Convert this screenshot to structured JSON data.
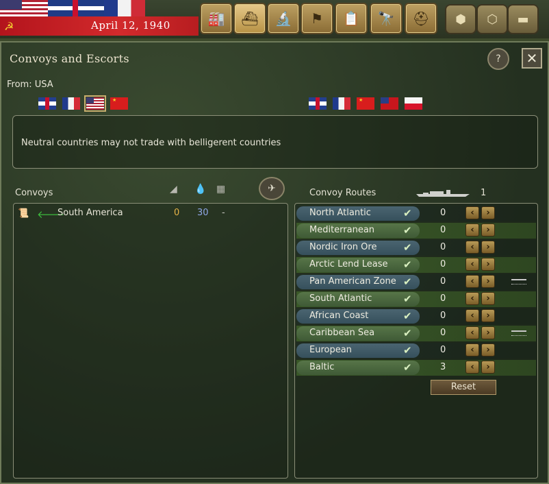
{
  "topbar": {
    "date": "April 12, 1940",
    "nav_buttons": [
      {
        "name": "production",
        "glyph": "🏭"
      },
      {
        "name": "convoys",
        "glyph": "⛴",
        "active": true
      },
      {
        "name": "research",
        "glyph": "🔬"
      },
      {
        "name": "objectives",
        "glyph": "⚑"
      },
      {
        "name": "reports",
        "glyph": "📋"
      },
      {
        "name": "intelligence",
        "glyph": "🔭"
      },
      {
        "name": "units",
        "glyph": "⛑"
      }
    ],
    "hex_buttons": [
      {
        "name": "hex-single",
        "glyph": "⬢"
      },
      {
        "name": "hex-multi",
        "glyph": "⬡"
      },
      {
        "name": "tank",
        "glyph": "▬"
      }
    ]
  },
  "window": {
    "title": "Convoys and Escorts",
    "help_label": "?",
    "close_label": "✕",
    "from_label": "From: USA",
    "source_flags": [
      "uk",
      "france",
      "usa",
      "china"
    ],
    "selected_source": "usa",
    "dest_flags": [
      "uk",
      "france",
      "china",
      "canada",
      "poland"
    ],
    "message": "Neutral countries may not trade with belligerent countries"
  },
  "convoys": {
    "header": "Convoys",
    "header_icons": [
      "steel-icon",
      "oil-icon",
      "resources-icon"
    ],
    "items": [
      {
        "name": "South America",
        "v1": "0",
        "v2": "30",
        "v3": "-"
      }
    ]
  },
  "routes": {
    "header": "Convoy Routes",
    "ship_count": "1",
    "reset_label": "Reset",
    "items": [
      {
        "name": "North Atlantic",
        "value": "0",
        "ship": false
      },
      {
        "name": "Mediterranean",
        "value": "0",
        "ship": false
      },
      {
        "name": "Nordic Iron Ore",
        "value": "0",
        "ship": false
      },
      {
        "name": "Arctic Lend Lease",
        "value": "0",
        "ship": false
      },
      {
        "name": "Pan American Zone",
        "value": "0",
        "ship": true
      },
      {
        "name": "South Atlantic",
        "value": "0",
        "ship": false
      },
      {
        "name": "African Coast",
        "value": "0",
        "ship": false
      },
      {
        "name": "Caribbean Sea",
        "value": "0",
        "ship": true
      },
      {
        "name": "European",
        "value": "0",
        "ship": false
      },
      {
        "name": "Baltic",
        "value": "3",
        "ship": false
      }
    ]
  },
  "colors": {
    "accent": "#c8ae6e",
    "check": "#d9efc0",
    "oil_value": "#8fa7e6",
    "steel_value": "#e5b347"
  }
}
